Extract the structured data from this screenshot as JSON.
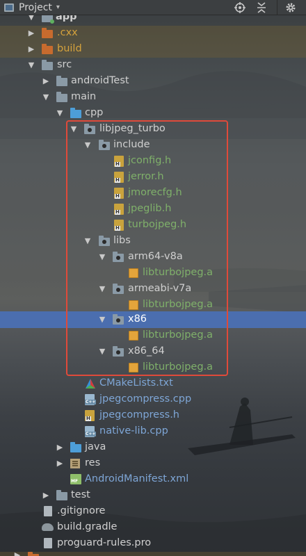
{
  "toolbar": {
    "title": "Project",
    "dropdown_icon": "chevron-down-icon",
    "buttons": [
      {
        "name": "locate-icon"
      },
      {
        "name": "collapse-all-icon"
      },
      {
        "name": "gear-icon"
      }
    ]
  },
  "tree": {
    "app": "app",
    "cxx": ".cxx",
    "build": "build",
    "src": "src",
    "androidTest": "androidTest",
    "main": "main",
    "cpp": "cpp",
    "libjpeg_turbo": "libjpeg_turbo",
    "include": "include",
    "jconfig": "jconfig.h",
    "jerror": "jerror.h",
    "jmorecfg": "jmorecfg.h",
    "jpeglib": "jpeglib.h",
    "turbojpeg": "turbojpeg.h",
    "libs": "libs",
    "arm64": "arm64-v8a",
    "arm64_lib": "libturbojpeg.a",
    "armeabi": "armeabi-v7a",
    "armeabi_lib": "libturbojpeg.a",
    "x86": "x86",
    "x86_lib": "libturbojpeg.a",
    "x86_64": "x86_64",
    "x86_64_lib": "libturbojpeg.a",
    "cmakelists": "CMakeLists.txt",
    "jpegcompress_cpp": "jpegcompress.cpp",
    "jpegcompress_h": "jpegcompress.h",
    "native_lib": "native-lib.cpp",
    "java": "java",
    "res": "res",
    "manifest": "AndroidManifest.xml",
    "test": "test",
    "gitignore": ".gitignore",
    "build_gradle": "build.gradle",
    "proguard": "proguard-rules.pro"
  },
  "colors": {
    "selection": "#4b6eaf",
    "annotation_box": "#e04a3a",
    "excluded_folder": "#c76b2e",
    "header_text": "#7fb06a"
  }
}
